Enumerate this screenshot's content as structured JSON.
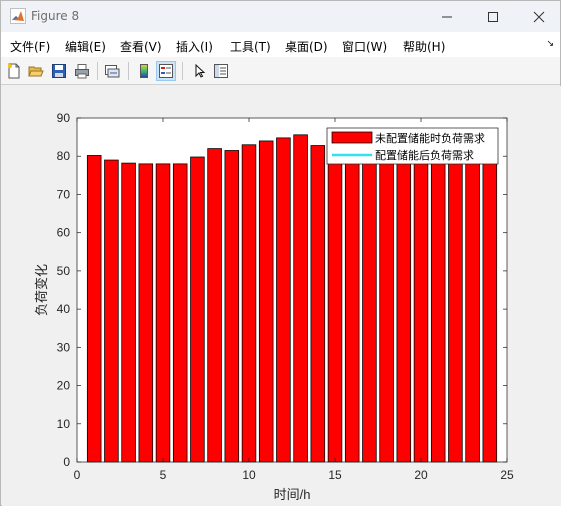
{
  "window": {
    "title": "Figure 8"
  },
  "menu": [
    {
      "label": "文件(F)"
    },
    {
      "label": "编辑(E)"
    },
    {
      "label": "查看(V)"
    },
    {
      "label": "插入(I)"
    },
    {
      "label": "工具(T)"
    },
    {
      "label": "桌面(D)"
    },
    {
      "label": "窗口(W)"
    },
    {
      "label": "帮助(H)"
    }
  ],
  "menu_overflow": "↘",
  "toolbar": {
    "buttons": [
      "new-figure-icon",
      "open-file-icon",
      "save-icon",
      "print-icon",
      "link-plot-icon",
      "colorbar-icon",
      "legend-icon",
      "edit-plot-arrow-icon",
      "property-inspector-icon"
    ]
  },
  "colors": {
    "bar_fill": "#ff0000",
    "bar_edge": "#000000",
    "line": "#33e0f0",
    "plot_bg": "#ffffff",
    "figure_bg": "#f0f0f0"
  },
  "chart_data": {
    "type": "bar",
    "title": "",
    "xlabel": "时间/h",
    "ylabel": "负荷变化",
    "xlim": [
      0,
      25
    ],
    "ylim": [
      0,
      90
    ],
    "xticks": [
      0,
      5,
      10,
      15,
      20,
      25
    ],
    "yticks": [
      0,
      10,
      20,
      30,
      40,
      50,
      60,
      70,
      80,
      90
    ],
    "x": [
      1,
      2,
      3,
      4,
      5,
      6,
      7,
      8,
      9,
      10,
      11,
      12,
      13,
      14,
      15,
      16,
      17,
      18,
      19,
      20,
      21,
      22,
      23,
      24
    ],
    "series": [
      {
        "name": "未配置储能时负荷需求",
        "kind": "bar",
        "values": [
          80.2,
          79.0,
          78.2,
          78.0,
          78.0,
          78.0,
          79.8,
          82.0,
          81.5,
          83.0,
          84.0,
          84.8,
          85.6,
          82.8,
          82.0,
          81.5,
          81.0,
          81.0,
          81.0,
          81.0,
          81.0,
          81.0,
          81.0,
          81.0
        ]
      },
      {
        "name": "配置储能后负荷需求",
        "kind": "line",
        "values": []
      }
    ],
    "legend": {
      "position": "top-right",
      "entries": [
        "未配置储能时负荷需求",
        "配置储能后负荷需求"
      ]
    },
    "grid": false
  }
}
